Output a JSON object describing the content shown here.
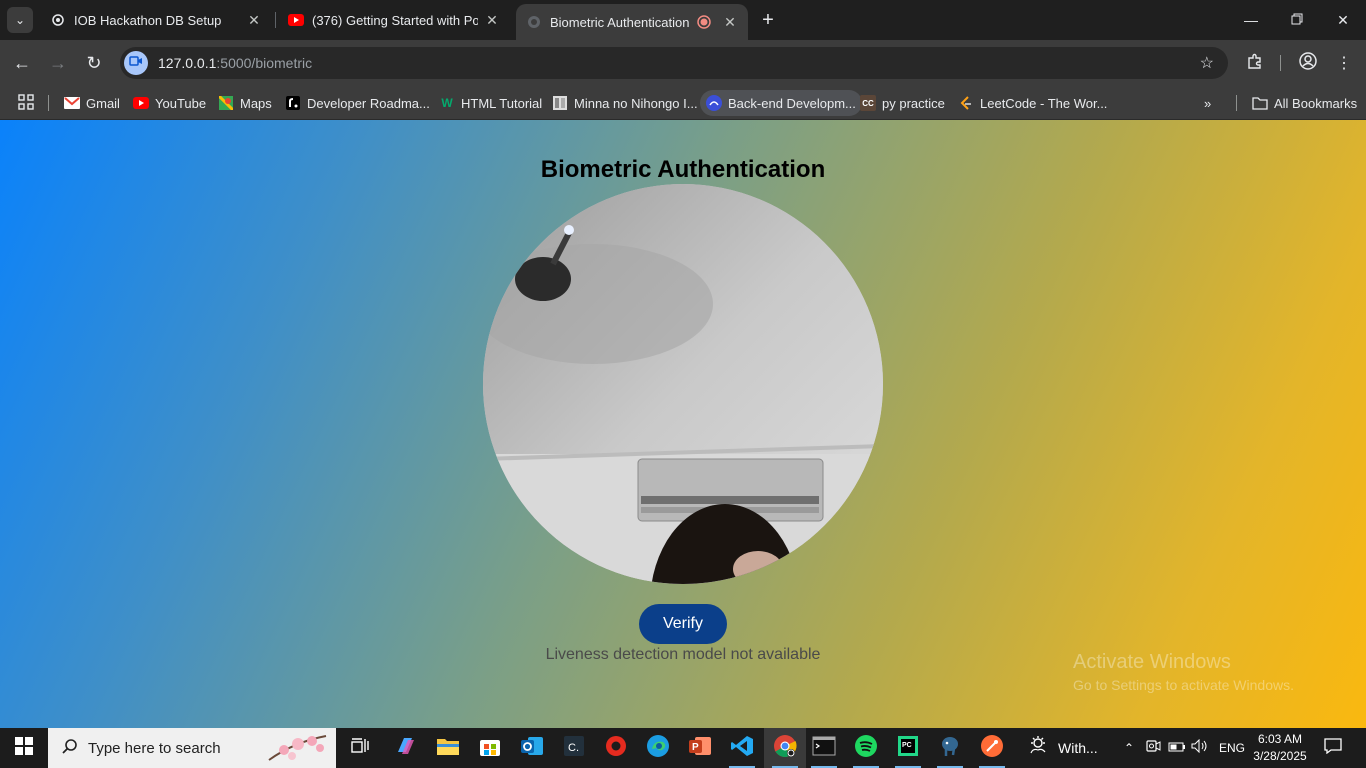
{
  "browser": {
    "tabs": [
      {
        "title": "IOB Hackathon DB Setup",
        "icon": "openai-icon",
        "active": false
      },
      {
        "title": "(376) Getting Started with Postg",
        "icon": "youtube-icon",
        "active": false
      },
      {
        "title": "Biometric Authentication",
        "icon": "globe-icon",
        "active": true,
        "recording": true
      }
    ],
    "url_host": "127.0.0.1",
    "url_path": ":5000/biometric",
    "bookmarks": [
      {
        "label": "Gmail",
        "icon": "gmail-icon"
      },
      {
        "label": "YouTube",
        "icon": "youtube-icon"
      },
      {
        "label": "Maps",
        "icon": "maps-icon"
      },
      {
        "label": "Developer Roadma...",
        "icon": "roadmap-icon"
      },
      {
        "label": "HTML Tutorial",
        "icon": "w3schools-icon"
      },
      {
        "label": "Minna no Nihongo I...",
        "icon": "book-icon"
      },
      {
        "label": "Back-end Developm...",
        "icon": "freecodecamp-icon"
      },
      {
        "label": "py practice",
        "icon": "codechef-icon"
      },
      {
        "label": "LeetCode - The Wor...",
        "icon": "leetcode-icon"
      }
    ],
    "all_bookmarks": "All Bookmarks"
  },
  "page": {
    "title": "Biometric Authentication",
    "verify_label": "Verify",
    "status": "Liveness detection model not available",
    "watermark_title": "Activate Windows",
    "watermark_sub": "Go to Settings to activate Windows."
  },
  "taskbar": {
    "search_placeholder": "Type here to search",
    "weather_text": "With...",
    "language": "ENG",
    "time": "6:03 AM",
    "date": "3/28/2025"
  },
  "colors": {
    "verify_button": "#0b3f8a",
    "tab_strip": "#1f1f1f",
    "toolbar": "#3c3c3c"
  }
}
